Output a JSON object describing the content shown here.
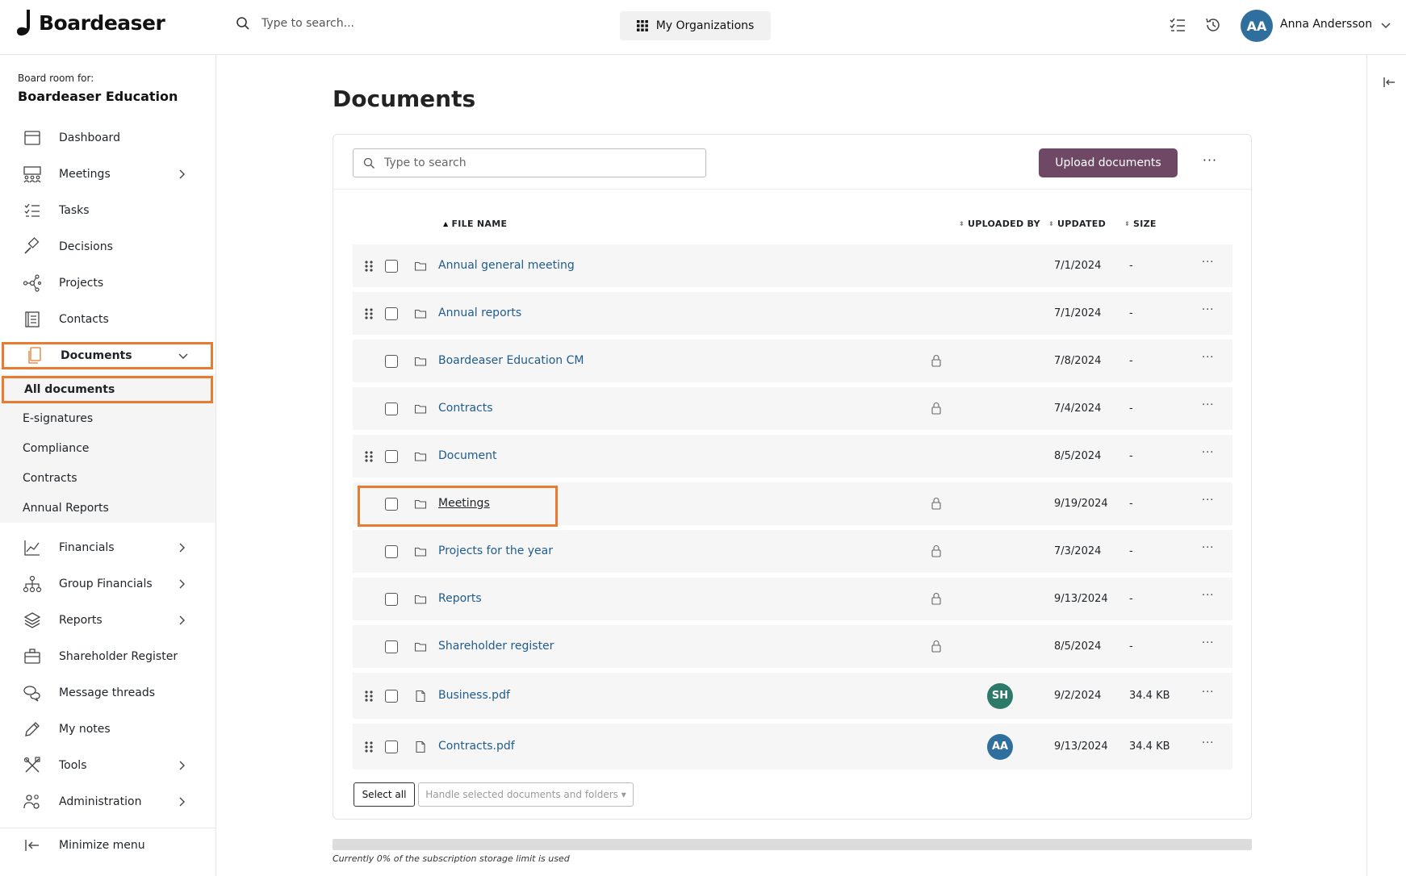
{
  "app": {
    "brand": "Boardeaser",
    "search_placeholder": "Type to search...",
    "org_button": "My Organizations",
    "user_initials": "AA",
    "user_name": "Anna Andersson",
    "avatar_color": "#2f6f9e"
  },
  "sidebar": {
    "board_for_label": "Board room for:",
    "board_name": "Boardeaser Education",
    "items": [
      {
        "label": "Dashboard",
        "icon": "calendar-icon"
      },
      {
        "label": "Meetings",
        "icon": "meeting-group-icon",
        "expandable": true
      },
      {
        "label": "Tasks",
        "icon": "checklist-icon"
      },
      {
        "label": "Decisions",
        "icon": "gavel-icon"
      },
      {
        "label": "Projects",
        "icon": "network-icon"
      },
      {
        "label": "Contacts",
        "icon": "contact-book-icon"
      },
      {
        "label": "Documents",
        "icon": "documents-icon",
        "expanded": true,
        "active": true
      },
      {
        "label": "Financials",
        "icon": "line-chart-icon",
        "expandable": true
      },
      {
        "label": "Group Financials",
        "icon": "org-chart-icon",
        "expandable": true
      },
      {
        "label": "Reports",
        "icon": "layers-icon",
        "expandable": true
      },
      {
        "label": "Shareholder Register",
        "icon": "briefcase-icon"
      },
      {
        "label": "Message threads",
        "icon": "chat-bubbles-icon"
      },
      {
        "label": "My notes",
        "icon": "pencil-icon"
      },
      {
        "label": "Tools",
        "icon": "tools-icon",
        "expandable": true
      },
      {
        "label": "Administration",
        "icon": "admin-users-icon",
        "expandable": true
      }
    ],
    "documents_submenu": [
      {
        "label": "All documents",
        "active": true
      },
      {
        "label": "E-signatures"
      },
      {
        "label": "Compliance"
      },
      {
        "label": "Contracts"
      },
      {
        "label": "Annual Reports"
      }
    ],
    "minimize_label": "Minimize menu"
  },
  "main": {
    "title": "Documents",
    "search_placeholder": "Type to search",
    "upload_button": "Upload documents",
    "more_glyph": "···",
    "columns": {
      "file_name": "FILE NAME",
      "uploaded_by": "UPLOADED BY",
      "updated": "UPDATED",
      "size": "SIZE"
    },
    "rows": [
      {
        "name": "Annual general meeting",
        "type": "folder",
        "drag": true,
        "locked": false,
        "uploader": "",
        "updated": "7/1/2024",
        "size": "-"
      },
      {
        "name": "Annual reports",
        "type": "folder",
        "drag": true,
        "locked": false,
        "uploader": "",
        "updated": "7/1/2024",
        "size": "-"
      },
      {
        "name": "Boardeaser Education CM",
        "type": "folder",
        "drag": false,
        "locked": true,
        "uploader": "",
        "updated": "7/8/2024",
        "size": "-"
      },
      {
        "name": "Contracts",
        "type": "folder",
        "drag": false,
        "locked": true,
        "uploader": "",
        "updated": "7/4/2024",
        "size": "-"
      },
      {
        "name": "Document",
        "type": "folder",
        "drag": true,
        "locked": false,
        "uploader": "",
        "updated": "8/5/2024",
        "size": "-"
      },
      {
        "name": "Meetings",
        "type": "folder",
        "drag": false,
        "locked": true,
        "uploader": "",
        "updated": "9/19/2024",
        "size": "-",
        "hovered": true
      },
      {
        "name": "Projects for the year",
        "type": "folder",
        "drag": false,
        "locked": true,
        "uploader": "",
        "updated": "7/3/2024",
        "size": "-"
      },
      {
        "name": "Reports",
        "type": "folder",
        "drag": false,
        "locked": true,
        "uploader": "",
        "updated": "9/13/2024",
        "size": "-"
      },
      {
        "name": "Shareholder register",
        "type": "folder",
        "drag": false,
        "locked": true,
        "uploader": "",
        "updated": "8/5/2024",
        "size": "-"
      },
      {
        "name": "Business.pdf",
        "type": "pdf",
        "drag": true,
        "locked": false,
        "uploader": "SH",
        "uploader_color": "#2e7a6a",
        "updated": "9/2/2024",
        "size": "34.4 KB"
      },
      {
        "name": "Contracts.pdf",
        "type": "pdf",
        "drag": true,
        "locked": false,
        "uploader": "AA",
        "uploader_color": "#2f6f9e",
        "updated": "9/13/2024",
        "size": "34.4 KB"
      }
    ],
    "select_all": "Select all",
    "handle_selected": "Handle selected documents and folders",
    "storage_used_fraction": 0,
    "storage_text": "Currently 0% of the subscription storage limit is used"
  }
}
